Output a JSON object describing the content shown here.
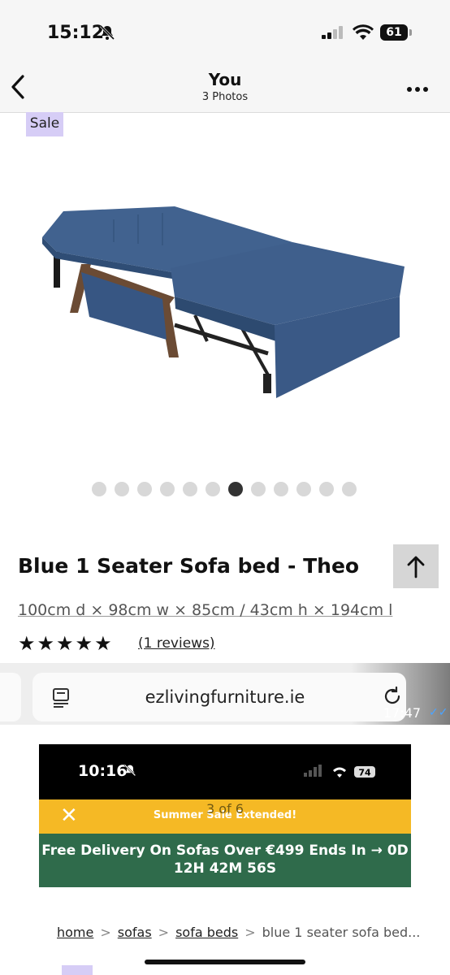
{
  "status_bar": {
    "time": "15:12",
    "battery": "61"
  },
  "nav": {
    "title": "You",
    "subtitle": "3 Photos"
  },
  "product": {
    "sale_badge": "Sale",
    "title": "Blue 1 Seater Sofa bed - Theo",
    "dimensions": "100cm d × 98cm w × 85cm / 43cm h × 194cm l",
    "rating_stars": "★★★★★",
    "rating_value": 5,
    "reviews_link": "(1 reviews)",
    "carousel": {
      "total": 12,
      "active_index": 6
    },
    "colors": {
      "sofa": "#3b5b86",
      "sale_badge": "#d6cdf6"
    }
  },
  "browser": {
    "url": "ezlivingfurniture.ie",
    "timestamp": "17:47",
    "checks": "✓✓"
  },
  "embedded": {
    "time": "10:16",
    "battery": "74",
    "promo_banner": "Summer Sale Extended!",
    "photo_counter": "3 of 6",
    "delivery_banner": "Free Delivery On Sofas Over €499 Ends In → 0D 12H 42M 56S",
    "breadcrumbs": [
      "home",
      "sofas",
      "sofa beds",
      "blue 1 seater sofa bed..."
    ],
    "colors": {
      "promo": "#f5b925",
      "delivery": "#2f6b4b"
    }
  }
}
